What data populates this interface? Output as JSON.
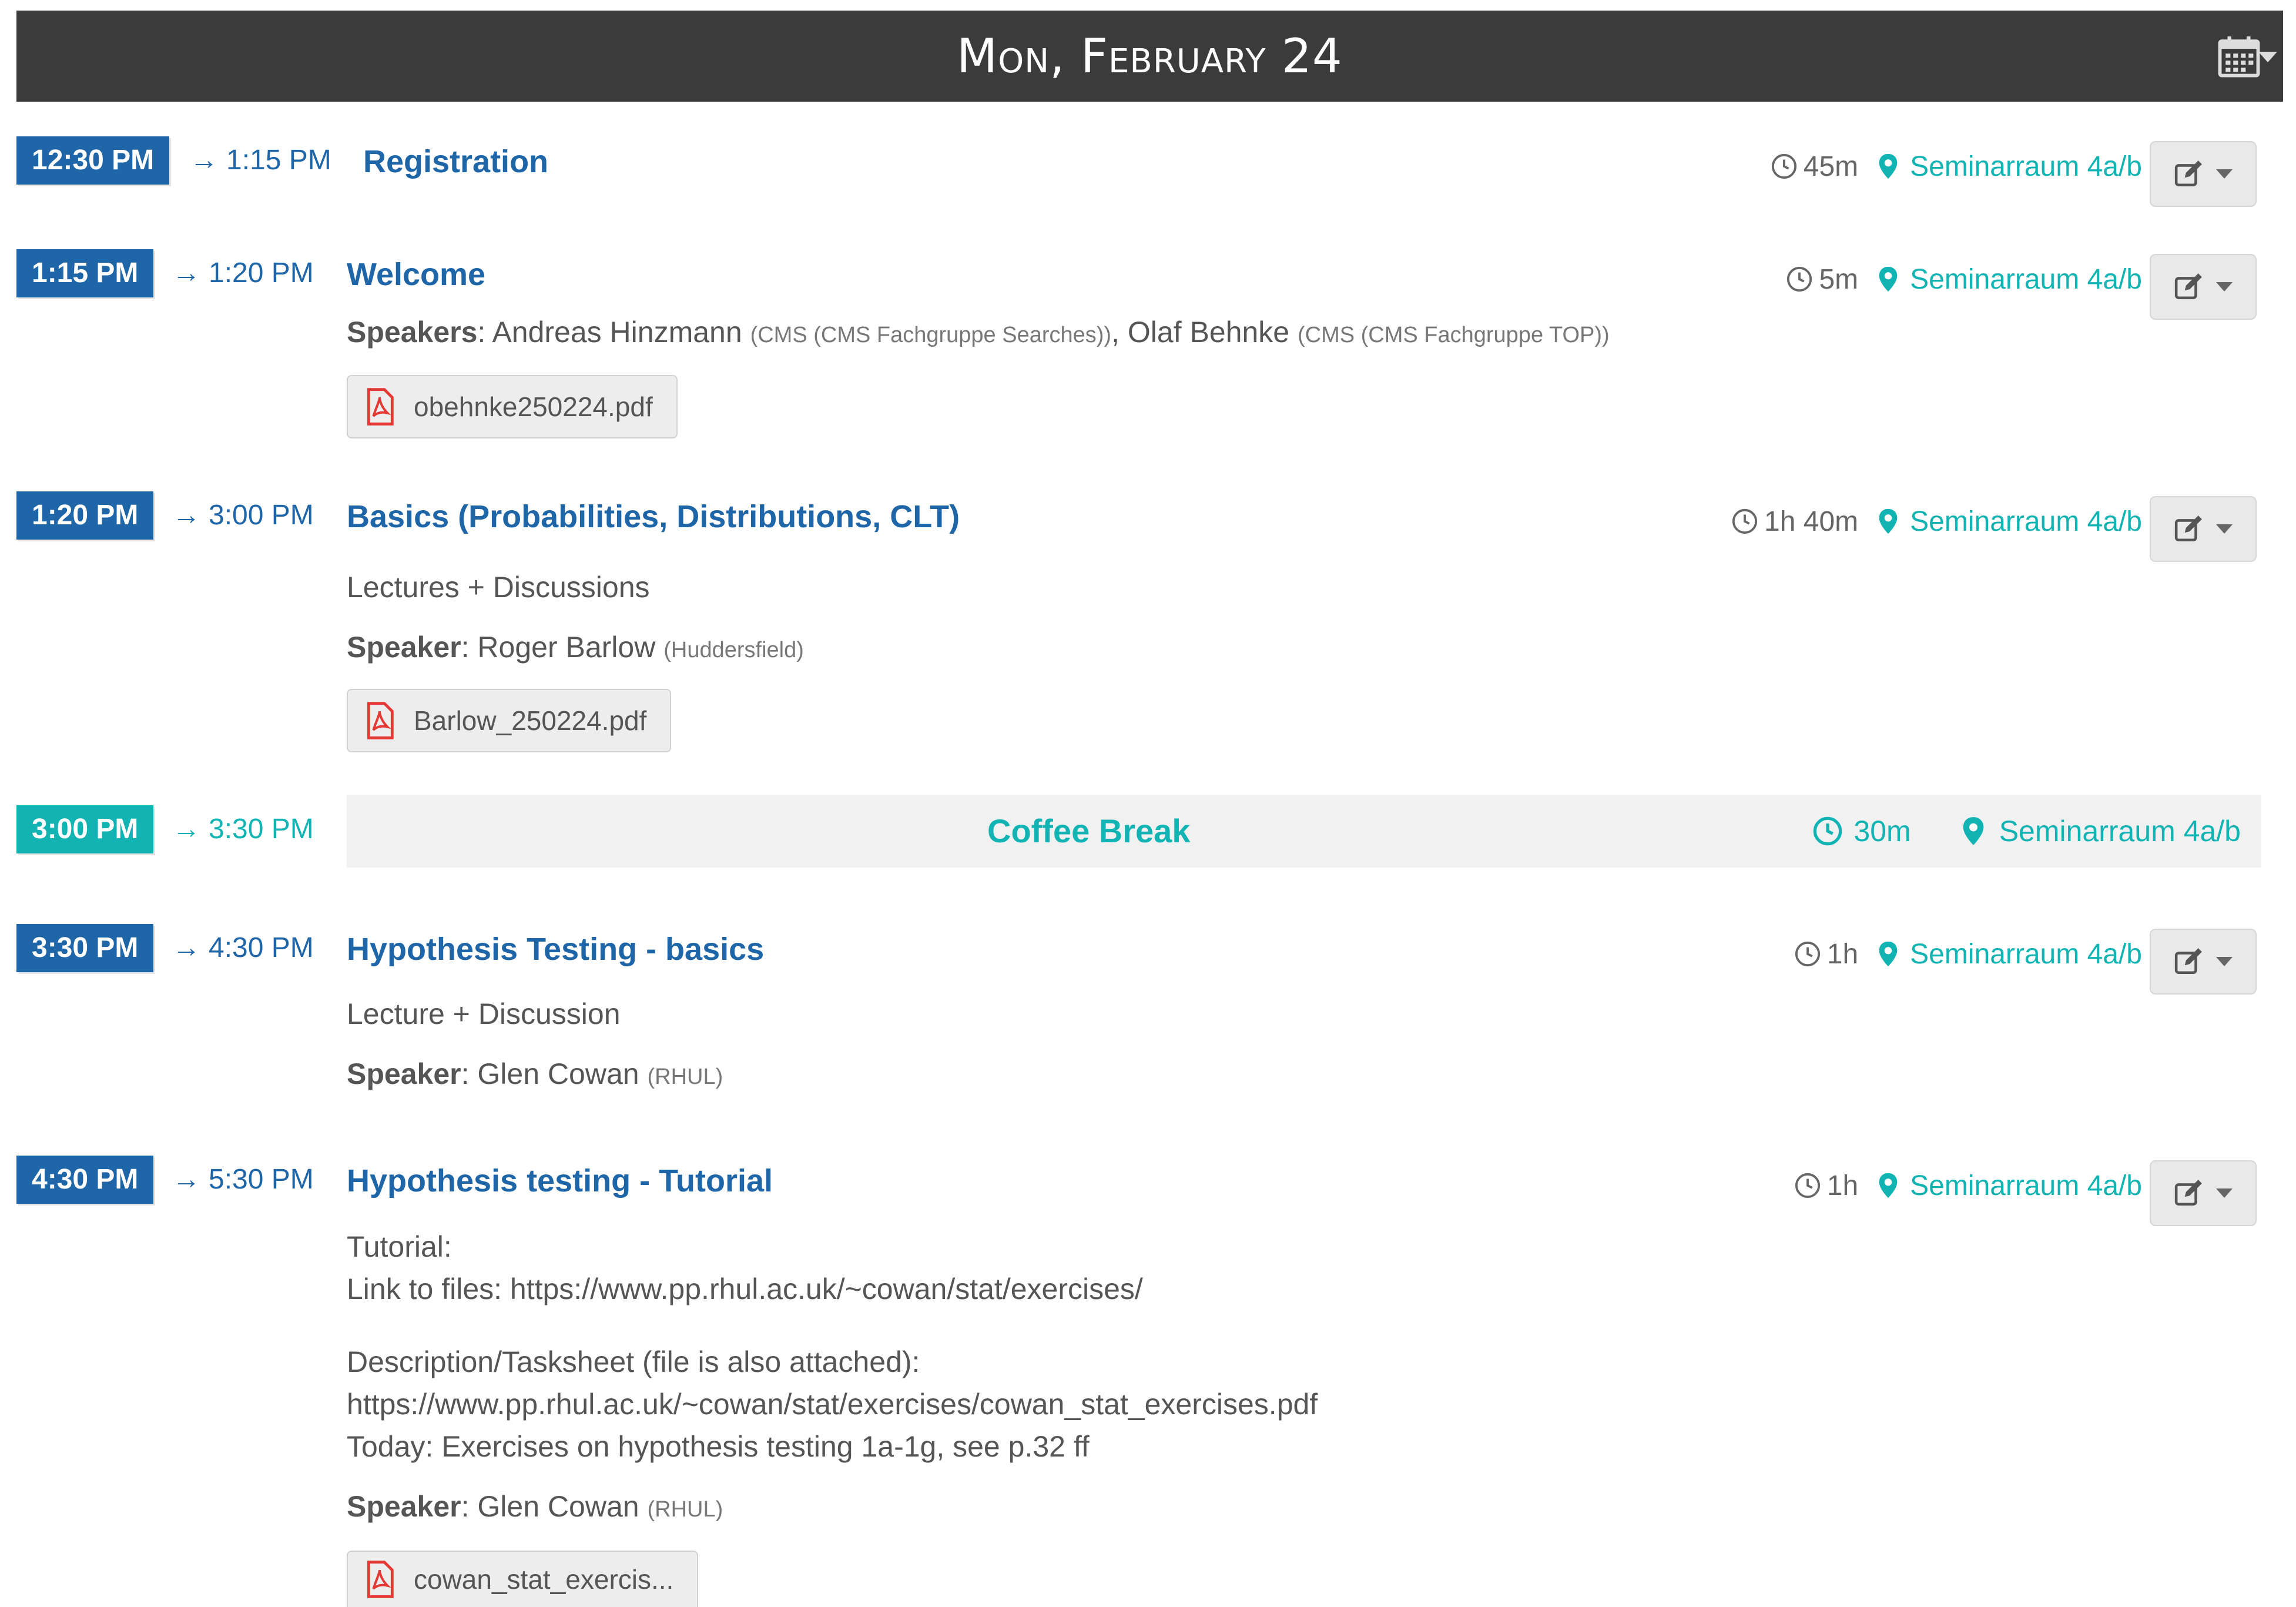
{
  "header": {
    "day_title": "Mon, February 24"
  },
  "entries": {
    "registration": {
      "start": "12:30 PM",
      "end": "1:15 PM",
      "title": "Registration",
      "duration": "45m",
      "location": "Seminarraum 4a/b"
    },
    "welcome": {
      "start": "1:15 PM",
      "end": "1:20 PM",
      "title": "Welcome",
      "duration": "5m",
      "location": "Seminarraum 4a/b",
      "speakers_label": "Speakers",
      "speaker1_name": "Andreas Hinzmann",
      "speaker1_aff": "(CMS (CMS Fachgruppe Searches))",
      "speaker2_name": "Olaf Behnke",
      "speaker2_aff": "(CMS (CMS Fachgruppe TOP))",
      "file": "obehnke250224.pdf"
    },
    "basics": {
      "start": "1:20 PM",
      "end": "3:00 PM",
      "title": "Basics (Probabilities, Distributions, CLT)",
      "duration": "1h 40m",
      "location": "Seminarraum 4a/b",
      "description": "Lectures + Discussions",
      "speaker_label": "Speaker",
      "speaker_name": "Roger Barlow",
      "speaker_aff": "(Huddersfield)",
      "file": "Barlow_250224.pdf"
    },
    "coffee": {
      "start": "3:00 PM",
      "end": "3:30 PM",
      "title": "Coffee Break",
      "duration": "30m",
      "location": "Seminarraum 4a/b"
    },
    "hyp_basics": {
      "start": "3:30 PM",
      "end": "4:30 PM",
      "title": "Hypothesis Testing - basics",
      "duration": "1h",
      "location": "Seminarraum 4a/b",
      "description": "Lecture + Discussion",
      "speaker_label": "Speaker",
      "speaker_name": "Glen Cowan",
      "speaker_aff": "(RHUL)"
    },
    "hyp_tutorial": {
      "start": "4:30 PM",
      "end": "5:30 PM",
      "title": "Hypothesis testing - Tutorial",
      "duration": "1h",
      "location": "Seminarraum 4a/b",
      "desc_line1": "Tutorial:",
      "desc_line2": "Link to files: https://www.pp.rhul.ac.uk/~cowan/stat/exercises/",
      "desc_line3": "Description/Tasksheet (file is also attached):",
      "desc_line4": "https://www.pp.rhul.ac.uk/~cowan/stat/exercises/cowan_stat_exercises.pdf",
      "desc_line5": "Today: Exercises on hypothesis testing 1a-1g, see p.32 ff",
      "speaker_label": "Speaker",
      "speaker_name": "Glen Cowan",
      "speaker_aff": "(RHUL)",
      "file": "cowan_stat_exercis..."
    }
  },
  "symbols": {
    "arrow": "→",
    "colon": ":"
  },
  "icons": {
    "calendar": "calendar-icon",
    "clock": "clock-icon",
    "location": "map-marker-icon",
    "edit": "edit-icon",
    "pdf": "pdf-file-icon"
  },
  "colors": {
    "header_bg": "#3b3b3b",
    "primary": "#1f66a8",
    "break": "#12b3b3",
    "pdf_red": "#e53935"
  }
}
